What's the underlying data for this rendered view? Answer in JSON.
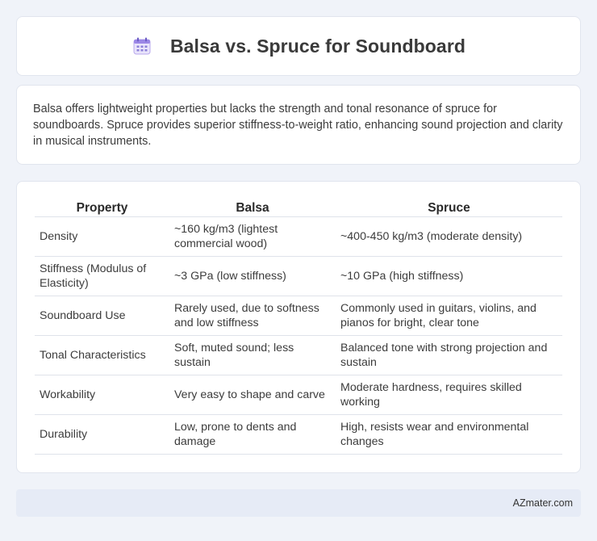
{
  "header": {
    "title": "Balsa vs. Spruce for Soundboard",
    "icon": "calendar-icon"
  },
  "summary": "Balsa offers lightweight properties but lacks the strength and tonal resonance of spruce for soundboards. Spruce provides superior stiffness-to-weight ratio, enhancing sound projection and clarity in musical instruments.",
  "table": {
    "headers": [
      "Property",
      "Balsa",
      "Spruce"
    ],
    "rows": [
      [
        "Density",
        "~160 kg/m3 (lightest commercial wood)",
        "~400-450 kg/m3 (moderate density)"
      ],
      [
        "Stiffness (Modulus of Elasticity)",
        "~3 GPa (low stiffness)",
        "~10 GPa (high stiffness)"
      ],
      [
        "Soundboard Use",
        "Rarely used, due to softness and low stiffness",
        "Commonly used in guitars, violins, and pianos for bright, clear tone"
      ],
      [
        "Tonal Characteristics",
        "Soft, muted sound; less sustain",
        "Balanced tone with strong projection and sustain"
      ],
      [
        "Workability",
        "Very easy to shape and carve",
        "Moderate hardness, requires skilled working"
      ],
      [
        "Durability",
        "Low, prone to dents and damage",
        "High, resists wear and environmental changes"
      ]
    ]
  },
  "footer": {
    "brand": "AZmater.com"
  }
}
